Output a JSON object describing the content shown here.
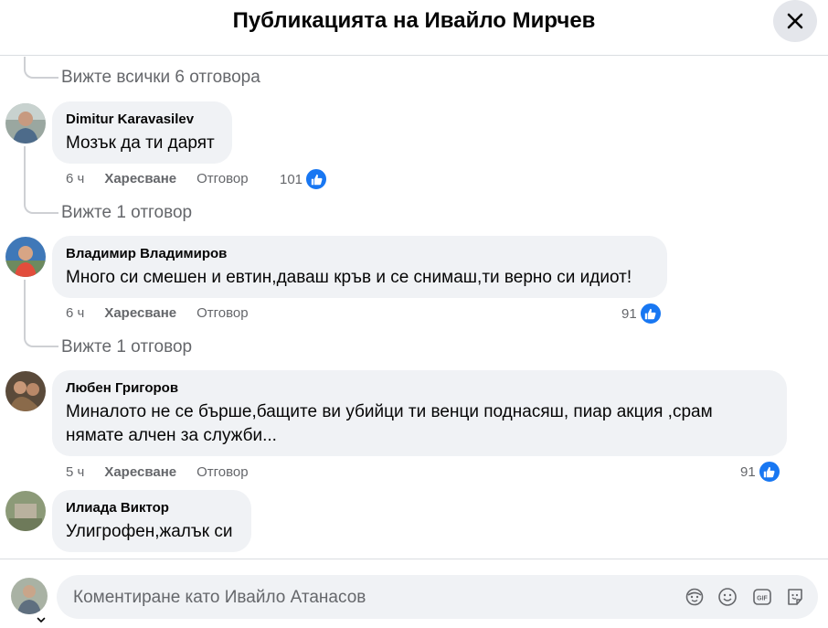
{
  "header": {
    "title": "Публикацията на Ивайло Мирчев"
  },
  "thread": {
    "view_all": "Вижте всички 6 отговора"
  },
  "comments": [
    {
      "author": "Dimitur Karavasilev",
      "text": "Мозък да ти дарят",
      "time": "6 ч",
      "like_label": "Харесване",
      "reply_label": "Отговор",
      "reactions": "101",
      "view_replies": "Вижте 1 отговор"
    },
    {
      "author": "Владимир Владимиров",
      "text": "Много си смешен и евтин,даваш кръв и се снимаш,ти верно си идиот!",
      "time": "6 ч",
      "like_label": "Харесване",
      "reply_label": "Отговор",
      "reactions": "91",
      "view_replies": "Вижте 1 отговор"
    },
    {
      "author": "Любен Григоров",
      "text_line1": "Миналото не се бърше,бащите ви убийци ти венци поднасяш, пиар акция ,срам",
      "text_line2": "нямате алчен за служби...",
      "time": "5 ч",
      "like_label": "Харесване",
      "reply_label": "Отговор",
      "reactions": "91"
    },
    {
      "author": "Илиада Виктор",
      "text": "Улигрофен,жалък си"
    }
  ],
  "composer": {
    "placeholder": "Коментиране като Ивайло Атанасов",
    "icons": [
      "avatar-sticker-icon",
      "emoji-icon",
      "gif-icon",
      "sticker-icon"
    ]
  },
  "colors": {
    "accent": "#1877f2",
    "bubble": "#f0f2f5",
    "secondary_text": "#65676b"
  }
}
